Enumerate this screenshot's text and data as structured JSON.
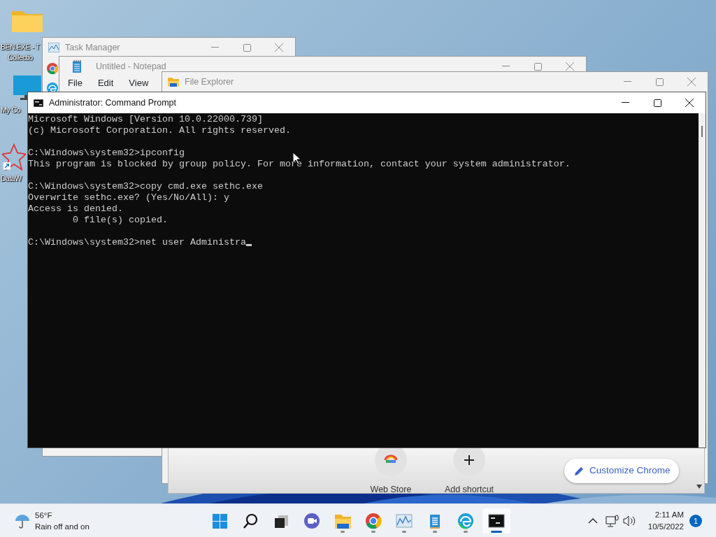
{
  "desktop_icons": [
    {
      "kind": "folder",
      "lines": [
        "BEN.EXE - T",
        "Collectio"
      ]
    },
    {
      "kind": "computer",
      "lines": [
        "My Co"
      ]
    },
    {
      "kind": "app",
      "lines": [
        "DataW"
      ]
    }
  ],
  "task_manager": {
    "title": "Task Manager",
    "active": false
  },
  "notepad": {
    "title": "Untitled - Notepad",
    "active": false,
    "menu": [
      "File",
      "Edit",
      "View"
    ]
  },
  "file_explorer": {
    "title": "File Explorer",
    "active": false
  },
  "chrome_page": {
    "shortcuts": [
      {
        "kind": "webstore",
        "label": "Web Store"
      },
      {
        "kind": "add",
        "label": "Add shortcut"
      }
    ],
    "customize_button": "Customize Chrome"
  },
  "command_prompt": {
    "title": "Administrator: Command Prompt",
    "active": true,
    "blocks": [
      [
        "Microsoft Windows [Version 10.0.22000.739]",
        "(c) Microsoft Corporation. All rights reserved."
      ],
      [
        "C:\\Windows\\system32>ipconfig",
        "This program is blocked by group policy. For more information, contact your system administrator."
      ],
      [
        "C:\\Windows\\system32>copy cmd.exe sethc.exe",
        "Overwrite sethc.exe? (Yes/No/All): y",
        "Access is denied.",
        "        0 file(s) copied."
      ],
      [
        "C:\\Windows\\system32>net user Administra"
      ]
    ],
    "cursor": true
  },
  "taskbar": {
    "weather": {
      "temperature": "56°F",
      "condition": "Rain off and on"
    },
    "apps": [
      {
        "kind": "start",
        "running": false,
        "active": false
      },
      {
        "kind": "search",
        "running": false,
        "active": false
      },
      {
        "kind": "taskview",
        "running": false,
        "active": false
      },
      {
        "kind": "chat",
        "running": false,
        "active": false
      },
      {
        "kind": "explorer",
        "running": true,
        "active": false
      },
      {
        "kind": "chrome",
        "running": true,
        "active": false
      },
      {
        "kind": "taskmgr",
        "running": true,
        "active": false
      },
      {
        "kind": "notepad",
        "running": true,
        "active": false
      },
      {
        "kind": "edge",
        "running": true,
        "active": false
      },
      {
        "kind": "terminal",
        "running": true,
        "active": true
      }
    ],
    "time": "2:11 AM",
    "date": "10/5/2022",
    "notifications": "1"
  }
}
